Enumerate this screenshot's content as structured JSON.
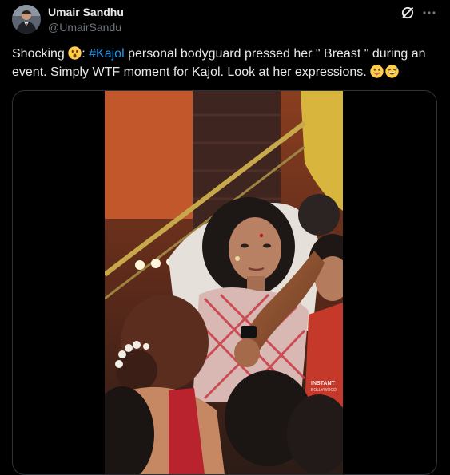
{
  "author": {
    "name": "Umair Sandhu",
    "handle": "@UmairSandu"
  },
  "tweet": {
    "text_before_hashtag": "Shocking ",
    "text_after_emoji_colon": ": ",
    "hashtag": "#Kajol",
    "text_after_hashtag": " personal bodyguard pressed her \" Breast \" during an event. Simply WTF moment for Kajol. Look at her expressions. "
  },
  "media": {
    "watermark_line1": "INSTANT",
    "watermark_line2": "BOLLYWOOD"
  },
  "icons": [
    "grok-icon",
    "more-icon",
    "astonished-face-emoji",
    "tongue-out-emoji",
    "sweat-smile-emoji"
  ],
  "colors": {
    "background": "#000000",
    "text": "#e7e9ea",
    "secondary_text": "#71767b",
    "link": "#1d9bf0",
    "border": "#2f3336"
  }
}
